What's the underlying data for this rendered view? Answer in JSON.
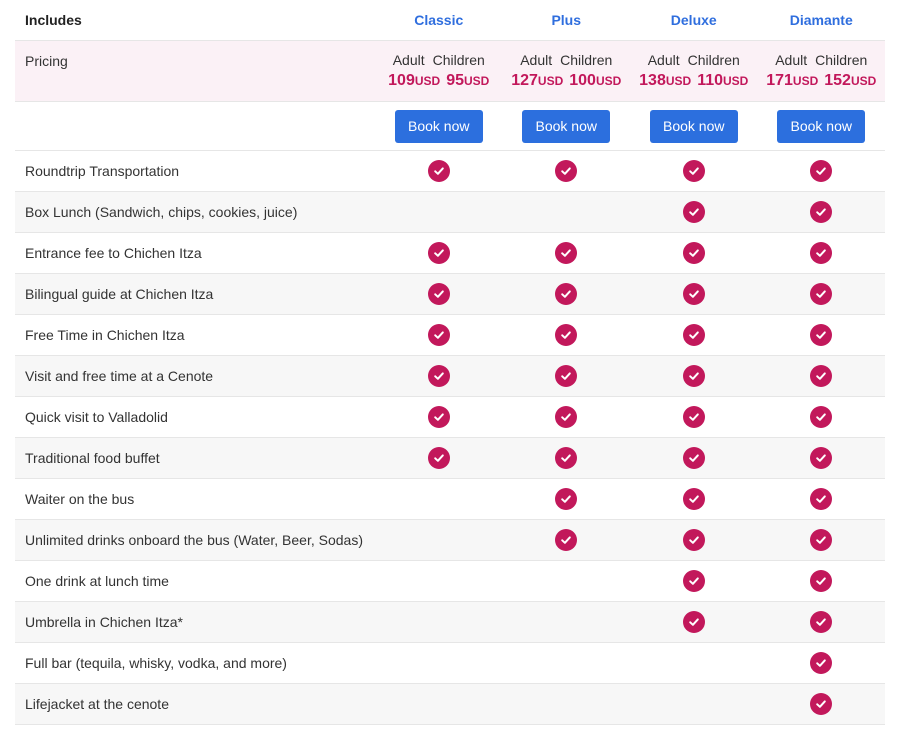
{
  "header": {
    "includes_label": "Includes",
    "plans": [
      "Classic",
      "Plus",
      "Deluxe",
      "Diamante"
    ]
  },
  "pricing": {
    "label": "Pricing",
    "adult_label": "Adult",
    "children_label": "Children",
    "currency": "USD",
    "prices": [
      {
        "adult": "109",
        "children": "95"
      },
      {
        "adult": "127",
        "children": "100"
      },
      {
        "adult": "138",
        "children": "110"
      },
      {
        "adult": "171",
        "children": "152"
      }
    ]
  },
  "book_label": "Book now",
  "features": [
    {
      "name": "Roundtrip Transportation",
      "included": [
        true,
        true,
        true,
        true
      ]
    },
    {
      "name": "Box Lunch (Sandwich, chips, cookies, juice)",
      "included": [
        false,
        false,
        true,
        true
      ]
    },
    {
      "name": "Entrance fee to Chichen Itza",
      "included": [
        true,
        true,
        true,
        true
      ]
    },
    {
      "name": "Bilingual guide at Chichen Itza",
      "included": [
        true,
        true,
        true,
        true
      ]
    },
    {
      "name": "Free Time in Chichen Itza",
      "included": [
        true,
        true,
        true,
        true
      ]
    },
    {
      "name": "Visit and free time at a Cenote",
      "included": [
        true,
        true,
        true,
        true
      ]
    },
    {
      "name": "Quick visit to Valladolid",
      "included": [
        true,
        true,
        true,
        true
      ]
    },
    {
      "name": "Traditional food buffet",
      "included": [
        true,
        true,
        true,
        true
      ]
    },
    {
      "name": "Waiter on the bus",
      "included": [
        false,
        true,
        true,
        true
      ]
    },
    {
      "name": "Unlimited drinks onboard the bus (Water, Beer, Sodas)",
      "included": [
        false,
        true,
        true,
        true
      ]
    },
    {
      "name": "One drink at lunch time",
      "included": [
        false,
        false,
        true,
        true
      ]
    },
    {
      "name": "Umbrella in Chichen Itza*",
      "included": [
        false,
        false,
        true,
        true
      ]
    },
    {
      "name": "Full bar (tequila, whisky, vodka, and more)",
      "included": [
        false,
        false,
        false,
        true
      ]
    },
    {
      "name": "Lifejacket at the cenote",
      "included": [
        false,
        false,
        false,
        true
      ]
    }
  ],
  "colors": {
    "plan_header": "#2f6ede",
    "price": "#c2185b",
    "check": "#c2185b",
    "button": "#2c6fde",
    "pricing_bg": "#fbf1f6",
    "alt_row_bg": "#f7f7f7"
  },
  "icons": {
    "check": "check-circle-icon"
  }
}
